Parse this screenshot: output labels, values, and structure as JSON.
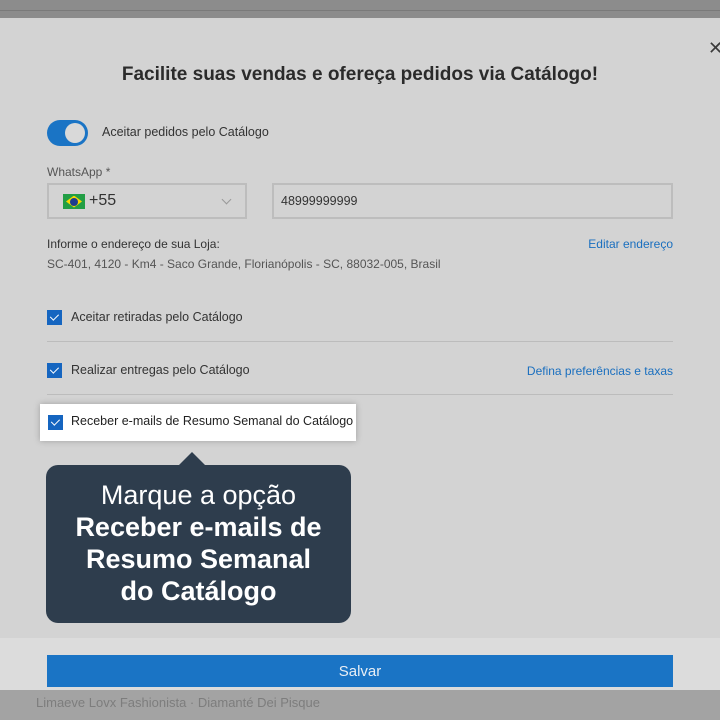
{
  "backdrop": {
    "bottom_text": "Limaeve Lovx Fashionista · Diamanté Dei Pisque"
  },
  "modal": {
    "close_icon": "close-icon",
    "title": "Facilite suas vendas e ofereça pedidos via Catálogo!",
    "toggle": {
      "label": "Aceitar pedidos pelo Catálogo",
      "on": true
    },
    "whatsapp": {
      "label": "WhatsApp *",
      "country_flag": "brazil-flag-icon",
      "dial_code": "+55",
      "phone_value": "48999999999"
    },
    "address": {
      "label": "Informe o endereço de sua Loja:",
      "value": "SC-401, 4120 - Km4 - Saco Grande, Florianópolis - SC, 88032-005, Brasil",
      "edit_link": "Editar endereço"
    },
    "options": {
      "pickup": {
        "label": "Aceitar retiradas pelo Catálogo",
        "checked": true
      },
      "delivery": {
        "label": "Realizar entregas pelo Catálogo",
        "checked": true,
        "link": "Defina preferências e taxas"
      },
      "weekly_email": {
        "label": "Receber e-mails de Resumo Semanal do Catálogo",
        "checked": true
      }
    },
    "save_label": "Salvar"
  },
  "tooltip": {
    "line1": "Marque a opção",
    "line2": "Receber e-mails de",
    "line3": "Resumo Semanal",
    "line4": "do Catálogo"
  },
  "colors": {
    "accent": "#1a74c5",
    "checkbox": "#1565c0",
    "link": "#1a6fbf",
    "tooltip_bg": "#2e3d4d",
    "modal_bg": "#d3d3d3"
  }
}
